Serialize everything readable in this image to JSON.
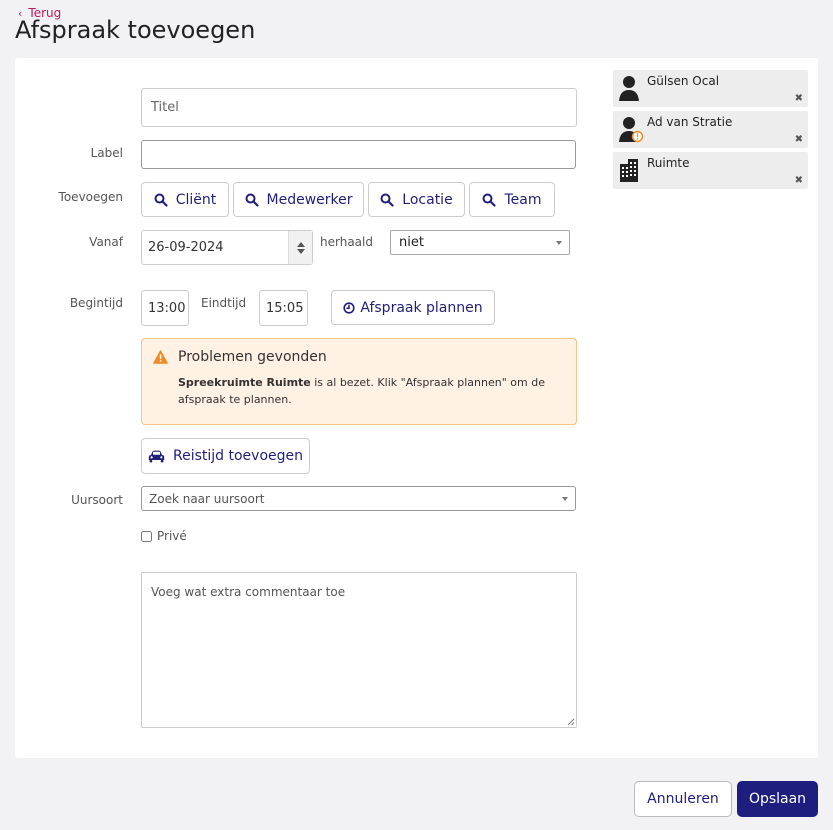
{
  "header": {
    "back_label": "Terug",
    "title": "Afspraak toevoegen"
  },
  "form": {
    "title_placeholder": "Titel",
    "label_label": "Label",
    "label_value": "",
    "add_label": "Toevoegen",
    "add_buttons": [
      {
        "label": "Cliënt",
        "icon": "search-icon"
      },
      {
        "label": "Medewerker",
        "icon": "search-icon"
      },
      {
        "label": "Locatie",
        "icon": "search-icon"
      },
      {
        "label": "Team",
        "icon": "search-icon"
      }
    ],
    "from_label": "Vanaf",
    "date_value": "26-09-2024",
    "repeat_label": "herhaald",
    "repeat_value": "niet",
    "start_time_label": "Begintijd",
    "start_time_value": "13:00",
    "end_time_label": "Eindtijd",
    "end_time_value": "15:05",
    "plan_button_label": "Afspraak plannen",
    "travel_button_label": "Reistijd toevoegen",
    "hour_type_label": "Uursoort",
    "hour_type_placeholder": "Zoek naar uursoort",
    "private_label": "Privé",
    "comment_placeholder": "Voeg wat extra commentaar toe"
  },
  "alert": {
    "title": "Problemen gevonden",
    "room_name": "Spreekruimte Ruimte",
    "message": " is al bezet. Klik \"Afspraak plannen\" om de afspraak te plannen.",
    "border_color": "#f3c38a",
    "background_color": "#fff1e3",
    "icon_color": "#f08a24"
  },
  "participants": [
    {
      "name": "Gülsen Ocal",
      "icon": "person-icon",
      "warning": false
    },
    {
      "name": "Ad van Stratie",
      "icon": "person-icon",
      "warning": true
    },
    {
      "name": "Ruimte",
      "icon": "building-icon",
      "warning": false
    }
  ],
  "footer": {
    "cancel_label": "Annuleren",
    "save_label": "Opslaan"
  },
  "colors": {
    "accent": "#1e1e7e",
    "back_link": "#c2185b"
  }
}
